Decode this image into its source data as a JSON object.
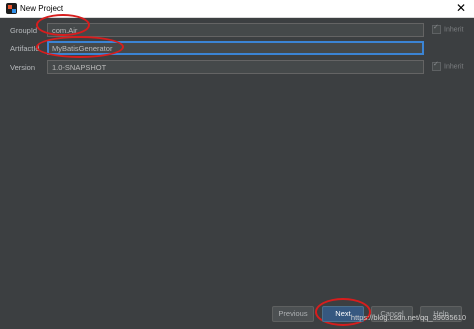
{
  "window": {
    "title": "New Project",
    "close_glyph": "✕",
    "app_icon": "intellij-icon"
  },
  "form": {
    "group_id": {
      "label": "GroupId",
      "value": "com.Air",
      "inherit_label": "Inherit",
      "inherit_checked": true
    },
    "artifact_id": {
      "label": "ArtifactId",
      "value": "MyBatisGenerator"
    },
    "version": {
      "label": "Version",
      "value": "1.0-SNAPSHOT",
      "inherit_label": "Inherit",
      "inherit_checked": true
    }
  },
  "buttons": {
    "previous": "Previous",
    "next": "Next",
    "cancel": "Cancel",
    "help": "Help"
  },
  "watermark": "https://blog.csdn.net/qq_39635610",
  "colors": {
    "background": "#3c3f41",
    "field": "#45494a",
    "focus": "#3b84d4",
    "default_button": "#365880",
    "annotation": "#d81d1d"
  }
}
